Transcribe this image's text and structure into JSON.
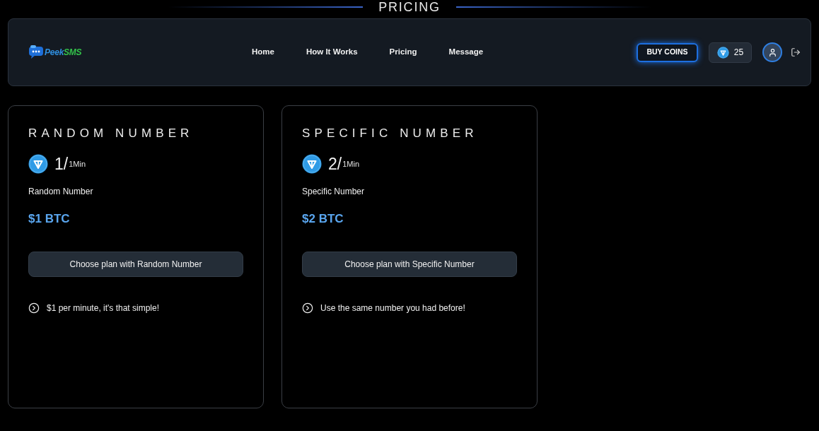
{
  "page_heading": "PRICING",
  "navbar": {
    "logo": {
      "text": "Peek",
      "accent": "SMS"
    },
    "links": [
      {
        "label": "Home"
      },
      {
        "label": "How It Works"
      },
      {
        "label": "Pricing"
      },
      {
        "label": "Message"
      }
    ],
    "buy_button": "BUY COINS",
    "coin_balance": "25"
  },
  "plans": [
    {
      "title": "RANDOM NUMBER",
      "rate": "1/",
      "rate_unit": "1Min",
      "name": "Random Number",
      "price": "$1 BTC",
      "button": "Choose plan with Random Number",
      "features": [
        "$1 per minute, it's that simple!"
      ]
    },
    {
      "title": "SPECIFIC NUMBER",
      "rate": "2/",
      "rate_unit": "1Min",
      "name": "Specific Number",
      "price": "$2 BTC",
      "button": "Choose plan with Specific Number",
      "features": [
        "Use the same number you had before!"
      ]
    }
  ]
}
